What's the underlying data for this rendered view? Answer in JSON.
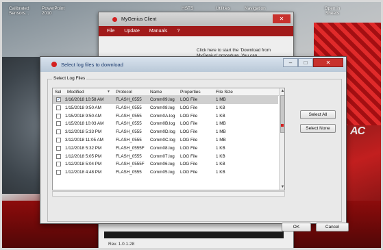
{
  "desktop": {
    "icons": [
      "Calibrated Sensors...",
      "PowerPoint 2010",
      "HSTS",
      "Utilities",
      "Navigation",
      "Open in Sheets"
    ]
  },
  "client": {
    "title": "MyGenius Client",
    "menu": [
      "File",
      "Update",
      "Manuals",
      "?"
    ],
    "hint": "Click here to start the 'Download from MyGenius' procedure. You can",
    "revision": "Rev. 1.0.1.28"
  },
  "dialog": {
    "title": "Select log files to download",
    "group_label": "Select Log Files",
    "columns": [
      "Sel",
      "Modified",
      "Protocol",
      "Name",
      "Properties",
      "File Size"
    ],
    "rows": [
      {
        "checked": true,
        "modified": "3/16/2018 10:58 AM",
        "protocol": "FLASH_0555",
        "name": "Comm09.log",
        "properties": "LOG File",
        "size": "1 MB"
      },
      {
        "checked": false,
        "modified": "1/15/2018 9:50 AM",
        "protocol": "FLASH_0555",
        "name": "Comm08.log",
        "properties": "LOG File",
        "size": "1 KB"
      },
      {
        "checked": false,
        "modified": "1/15/2018 9:50 AM",
        "protocol": "FLASH_0555",
        "name": "Comm0A.log",
        "properties": "LOG File",
        "size": "1 KB"
      },
      {
        "checked": false,
        "modified": "1/15/2018 10:03 AM",
        "protocol": "FLASH_0555",
        "name": "Comm0B.log",
        "properties": "LOG File",
        "size": "1 MB"
      },
      {
        "checked": false,
        "modified": "3/12/2018 5:33 PM",
        "protocol": "FLASH_0555",
        "name": "Comm0D.log",
        "properties": "LOG File",
        "size": "1 MB"
      },
      {
        "checked": false,
        "modified": "3/12/2018 11:05 AM",
        "protocol": "FLASH_0555",
        "name": "Comm0C.log",
        "properties": "LOG File",
        "size": "1 MB"
      },
      {
        "checked": false,
        "modified": "1/12/2018 5:32 PM",
        "protocol": "FLASH_0555F",
        "name": "Comm08.log",
        "properties": "LOG File",
        "size": "1 KB"
      },
      {
        "checked": false,
        "modified": "1/12/2018 5:05 PM",
        "protocol": "FLASH_0555",
        "name": "Comm07.log",
        "properties": "LOG File",
        "size": "1 KB"
      },
      {
        "checked": false,
        "modified": "1/12/2018 5:04 PM",
        "protocol": "FLASH_0555F",
        "name": "Comm06.log",
        "properties": "LOG File",
        "size": "1 KB"
      },
      {
        "checked": false,
        "modified": "1/12/2018 4:48 PM",
        "protocol": "FLASH_0555",
        "name": "Comm05.log",
        "properties": "LOG File",
        "size": "1 KB"
      }
    ],
    "buttons": {
      "select_all": "Select All",
      "select_none": "Select None",
      "ok": "OK",
      "cancel": "Cancel"
    }
  },
  "colors": {
    "brand_red": "#d32020",
    "dialog_title_text": "#1c3b6e",
    "selected_row": "#cfcfcf"
  }
}
